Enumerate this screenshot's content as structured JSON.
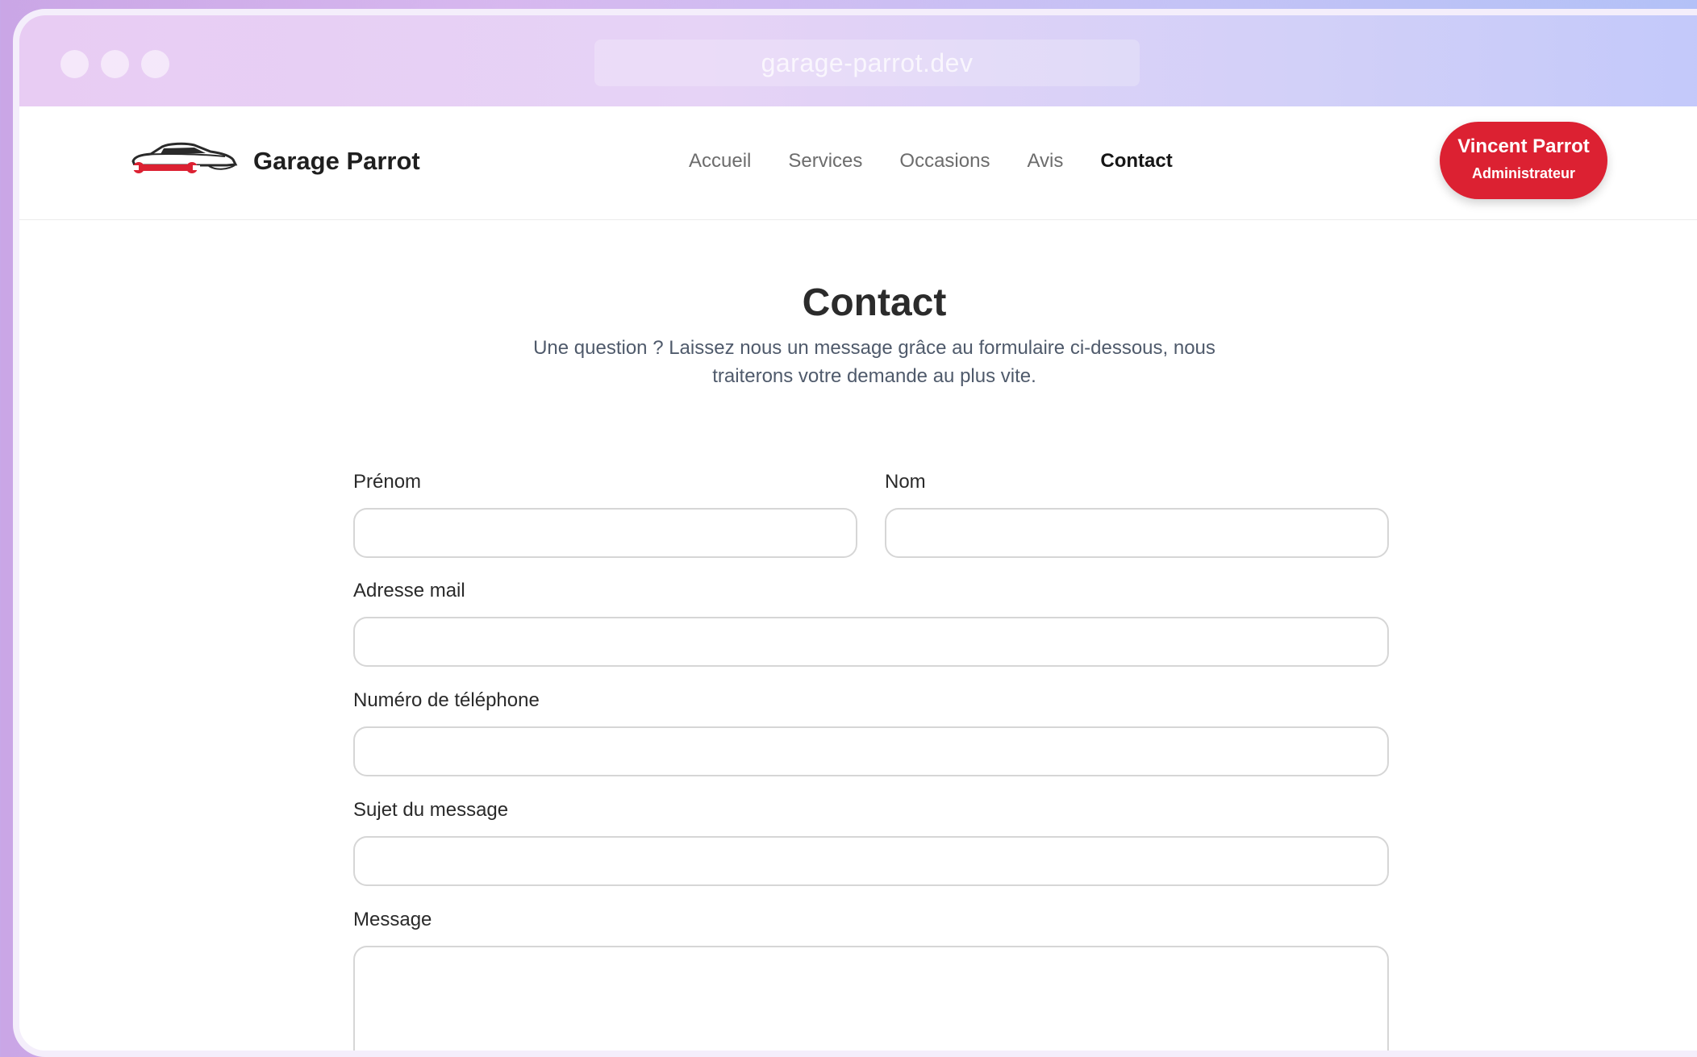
{
  "browser": {
    "url": "garage-parrot.dev"
  },
  "header": {
    "brand": "Garage Parrot",
    "nav": [
      "Accueil",
      "Services",
      "Occasions",
      "Avis",
      "Contact"
    ],
    "active_nav": "Contact",
    "user": {
      "name": "Vincent Parrot",
      "role": "Administrateur"
    }
  },
  "page": {
    "title": "Contact",
    "subtitle_line1": "Une question ? Laissez nous un message grâce au formulaire ci-dessous, nous",
    "subtitle_line2": "traiterons votre demande au plus vite."
  },
  "form": {
    "firstname_label": "Prénom",
    "lastname_label": "Nom",
    "email_label": "Adresse mail",
    "phone_label": "Numéro de téléphone",
    "subject_label": "Sujet du message",
    "message_label": "Message",
    "firstname_value": "",
    "lastname_value": "",
    "email_value": "",
    "phone_value": "",
    "subject_value": "",
    "message_value": ""
  },
  "colors": {
    "accent": "#dc2132",
    "text_dark": "#1f1f1f",
    "nav_text": "#6c6c6c",
    "subtitle": "#4f5a6b"
  },
  "icons": {
    "logo": "car-wrench-logo-icon"
  }
}
